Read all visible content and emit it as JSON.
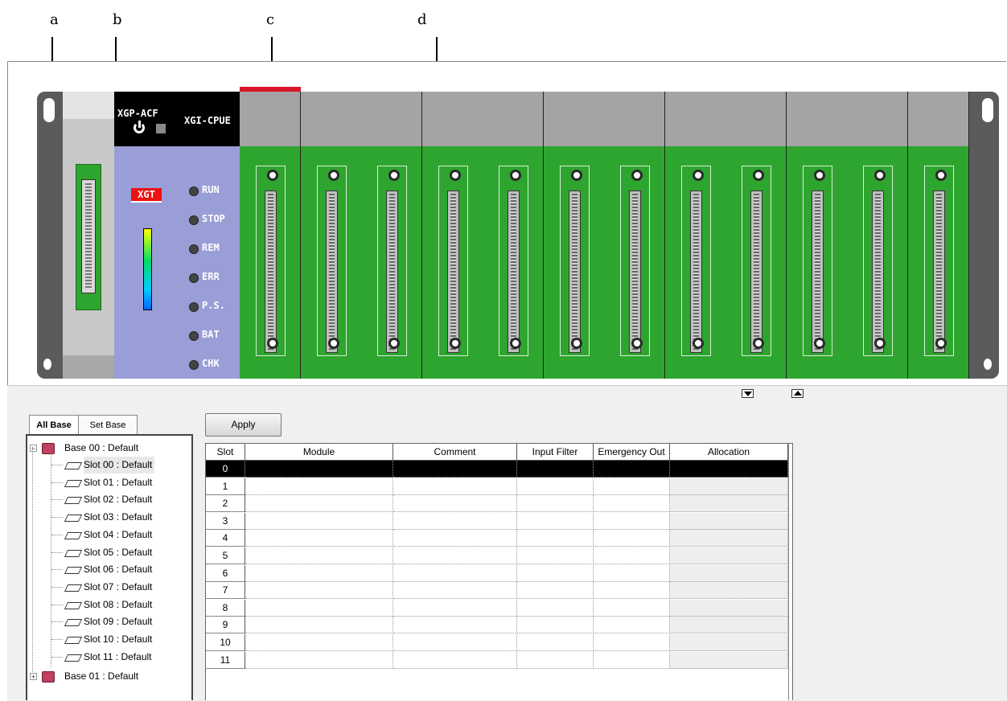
{
  "callouts": {
    "a": "a",
    "b": "b",
    "c": "c",
    "d": "d"
  },
  "rack": {
    "power_module": {
      "name": "XGP-ACF"
    },
    "cpu_module": {
      "name": "XGI-CPUE",
      "brand": "XGT",
      "leds": [
        "RUN",
        "STOP",
        "REM",
        "ERR",
        "P.S.",
        "BAT",
        "CHK"
      ]
    },
    "slot_count": 12,
    "colors": {
      "slot_green": "#2ea52e",
      "module_blue": "#9a9ed6",
      "slot_grey": "#a4a4a6",
      "selected_red": "#d8152a"
    }
  },
  "tabs": {
    "all_base": "All Base",
    "set_base": "Set Base"
  },
  "tree": {
    "base00": "Base 00 : Default",
    "slots": [
      "Slot 00 : Default",
      "Slot 01 : Default",
      "Slot 02 : Default",
      "Slot 03 : Default",
      "Slot 04 : Default",
      "Slot 05 : Default",
      "Slot 06 : Default",
      "Slot 07 : Default",
      "Slot 08 : Default",
      "Slot 09 : Default",
      "Slot 10 : Default",
      "Slot 11 : Default"
    ],
    "base01": "Base 01 : Default"
  },
  "apply_label": "Apply",
  "table": {
    "columns": [
      "Slot",
      "Module",
      "Comment",
      "Input Filter",
      "Emergency Out",
      "Allocation"
    ],
    "rows": [
      {
        "slot": "0"
      },
      {
        "slot": "1"
      },
      {
        "slot": "2"
      },
      {
        "slot": "3"
      },
      {
        "slot": "4"
      },
      {
        "slot": "5"
      },
      {
        "slot": "6"
      },
      {
        "slot": "7"
      },
      {
        "slot": "8"
      },
      {
        "slot": "9"
      },
      {
        "slot": "10"
      },
      {
        "slot": "11"
      }
    ],
    "selected_row": 0
  }
}
